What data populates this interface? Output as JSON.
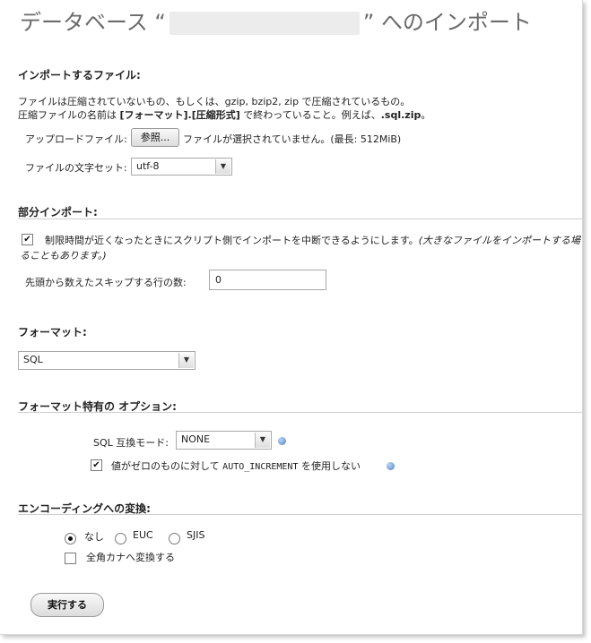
{
  "title": {
    "prefix": "データベース “",
    "suffix": "” へのインポート"
  },
  "file_section": {
    "heading": "インポートするファイル:",
    "desc1": "ファイルは圧縮されていないもの、もしくは、gzip, bzip2, zip で圧縮されているもの。",
    "desc2_a": "圧縮ファイルの名前は ",
    "desc2_bold": "[フォーマット].[圧縮形式]",
    "desc2_b": " で終わっていること。例えば、",
    "desc2_example": ".sql.zip",
    "desc2_c": "。",
    "upload_label": "アップロードファイル:",
    "browse_button": "参照...",
    "no_file_text": "ファイルが選択されていません。(最長: 512MiB)",
    "charset_label": "ファイルの文字セット:",
    "charset_value": "utf-8"
  },
  "partial_section": {
    "heading": "部分インポート:",
    "interrupt_label": "制限時間が近くなったときにスクリプト側でインポートを中断できるようにします。",
    "interrupt_note_1": "(大きなファイルをインポートする場",
    "interrupt_note_2": "ることもあります。)",
    "interrupt_checked": true,
    "skip_label": "先頭から数えたスキップする行の数:",
    "skip_value": "0"
  },
  "format_section": {
    "heading": "フォーマット:",
    "format_value": "SQL"
  },
  "options_section": {
    "heading": "フォーマット特有の オプション:",
    "compat_label": "SQL 互換モード:",
    "compat_value": "NONE",
    "auto_inc_label_a": "値がゼロのものに対して ",
    "auto_inc_code": "AUTO_INCREMENT",
    "auto_inc_label_b": " を使用しない",
    "auto_inc_checked": true
  },
  "encoding_section": {
    "heading": "エンコーディングへの変換:",
    "options": [
      "なし",
      "EUC",
      "SJIS"
    ],
    "selected": "なし",
    "kana_label": "全角カナへ変換する",
    "kana_checked": false
  },
  "submit_button": "実行する",
  "icons": {
    "help": "help-icon",
    "dropdown": "chevron-down-icon",
    "check": "checkmark-icon"
  }
}
